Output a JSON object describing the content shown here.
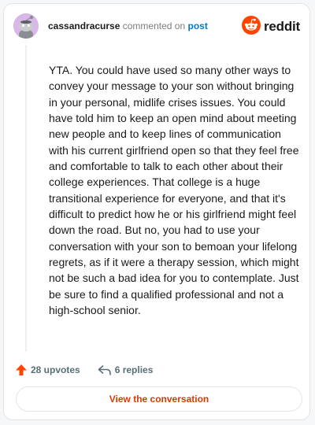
{
  "header": {
    "username": "cassandracurse",
    "action_text": "commented on",
    "post_link": "post",
    "brand": "reddit",
    "avatar_icon": "snoo-avatar-icon",
    "brand_icon": "reddit-logo-icon"
  },
  "comment": {
    "text": "YTA. You could have used so many other ways to convey your message to your son without bringing in your personal, midlife crises issues. You could have told him to keep an open mind about meeting new people and to keep lines of communication with his current girlfriend open so that they feel free and comfortable to talk to each other about their college experiences. That college is a huge transitional experience for everyone, and that it's difficult to predict how he or his girlfriend might feel down the road. But no, you had to use your conversation with your son to bemoan your lifelong regrets, as if it were a therapy session, which might not be such a bad idea for you to contemplate. Just be sure to find a qualified professional and not a high-school senior."
  },
  "stats": {
    "upvotes": "28 upvotes",
    "replies": "6 replies",
    "upvote_icon": "upvote-arrow-icon",
    "reply_icon": "reply-arrow-icon"
  },
  "cta": {
    "label": "View the conversation"
  },
  "colors": {
    "brand_orange": "#ff4500",
    "link_blue": "#0079d3",
    "cta_text": "#d93a00",
    "muted": "#576f76"
  }
}
